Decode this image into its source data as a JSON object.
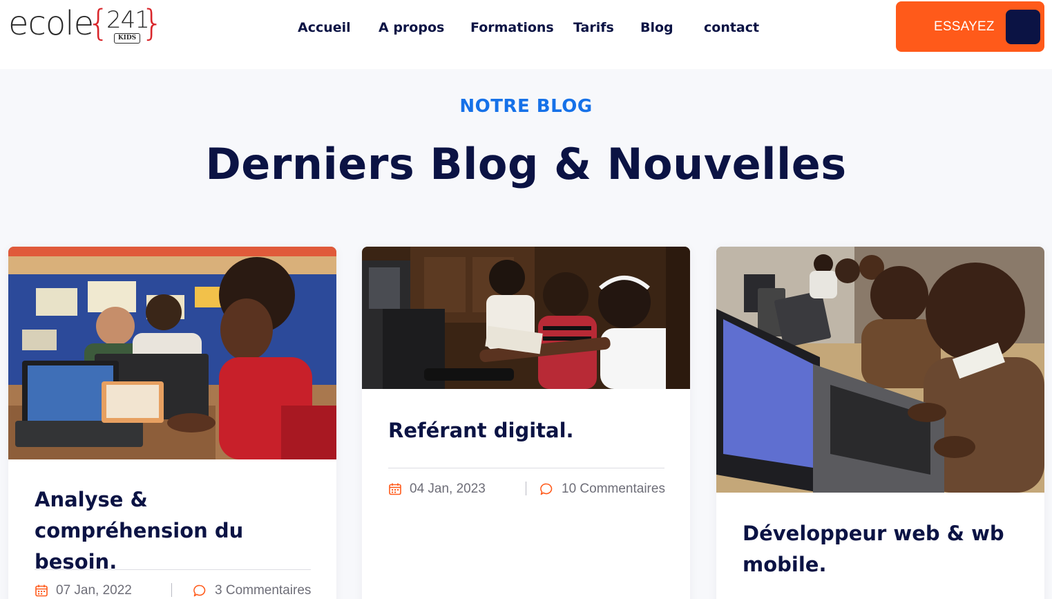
{
  "header": {
    "logo": {
      "word": "ecole",
      "brace_open": "{",
      "number": "241",
      "brace_close": "}",
      "badge": "KIDS"
    },
    "nav": [
      {
        "label": "Accueil"
      },
      {
        "label": "A propos"
      },
      {
        "label": "Formations"
      },
      {
        "label": "Tarifs"
      },
      {
        "label": "Blog"
      },
      {
        "label": "contact"
      }
    ],
    "cta": {
      "label": "ESSAYEZ"
    }
  },
  "section": {
    "tag": "NOTRE BLOG",
    "title": "Derniers Blog & Nouvelles"
  },
  "posts": [
    {
      "title": "Analyse & compréhension du besoin.",
      "date": "07 Jan, 2022",
      "comments": "3 Commentaires",
      "image": "girl-coding-laptop-classroom"
    },
    {
      "title": "Reférant digital.",
      "date": "04 Jan, 2023",
      "comments": "10 Commentaires",
      "image": "girls-at-computers"
    },
    {
      "title": "Développeur web & wb mobile.",
      "date": "",
      "comments": "",
      "image": "boys-using-laptops"
    }
  ],
  "colors": {
    "brand_orange": "#ff5a1a",
    "navy": "#0b1344",
    "accent_blue": "#1671e8",
    "logo_red": "#d9262b"
  }
}
